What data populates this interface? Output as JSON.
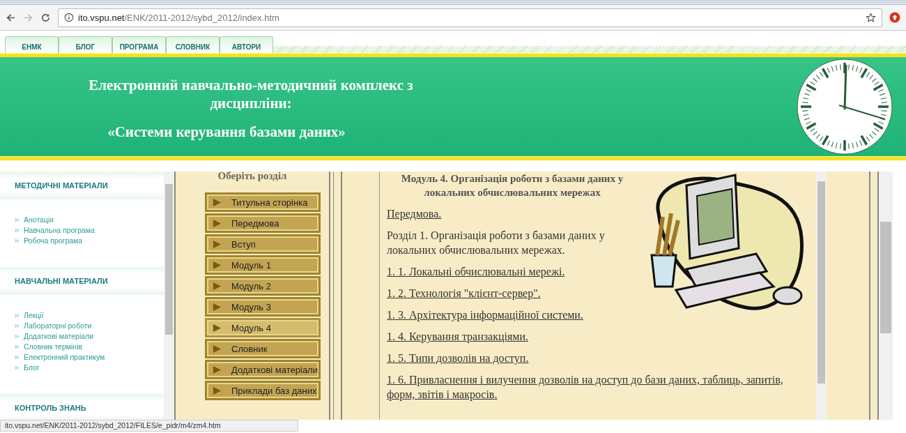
{
  "browser": {
    "url_host": "ito.vspu.net",
    "url_path": "/ENK/2011-2012/sybd_2012/index.htm",
    "status_url": "ito.vspu.net/ENK/2011-2012/sybd_2012/FILES/e_pidr/m4/zm4.htm"
  },
  "nav_tabs": [
    "ЕНМК",
    "БЛОГ",
    "ПРОГРАМА",
    "СЛОВНИК",
    "АВТОРИ"
  ],
  "banner": {
    "title_lines": [
      "Електронний навчально-методичний комплекс з",
      "дисципліни:"
    ],
    "subtitle": "«Системи керування базами даних»"
  },
  "sidebar": {
    "sections": [
      {
        "heading": "МЕТОДИЧНІ МАТЕРІАЛИ",
        "items": [
          "Анотація",
          "Навчальна програма",
          "Робоча програма"
        ]
      },
      {
        "heading": "НАВЧАЛЬНІ МАТЕРІАЛИ",
        "items": [
          "Лекції",
          "Лабораторні роботи",
          "Додаткові матеріали",
          "Словник термінів",
          "Електронний практикум",
          "Блог"
        ]
      },
      {
        "heading": "КОНТРОЛЬ ЗНАНЬ"
      }
    ]
  },
  "menu": {
    "title": "Оберіть розділ",
    "items": [
      {
        "label": "Титульна сторінка",
        "selected": false
      },
      {
        "label": "Передмова",
        "selected": false
      },
      {
        "label": "Вступ",
        "selected": false
      },
      {
        "label": "Модуль 1",
        "selected": false
      },
      {
        "label": "Модуль 2",
        "selected": false
      },
      {
        "label": "Модуль 3",
        "selected": false
      },
      {
        "label": "Модуль 4",
        "selected": true
      },
      {
        "label": "Словник",
        "selected": false
      },
      {
        "label": "Додаткові матеріали",
        "selected": false
      },
      {
        "label": "Приклади баз даних",
        "selected": false
      }
    ]
  },
  "content": {
    "heading_lines": [
      "Модуль 4. Організація роботи з базами даних у",
      "локальних обчислювальних мережах"
    ],
    "paragraphs": [
      {
        "kind": "link",
        "text": "Передмова."
      },
      {
        "kind": "plain",
        "text": "Розділ 1. Організація роботи з базами даних у локальних обчислювальних мережах."
      },
      {
        "kind": "link",
        "text": "1. 1. Локальні обчислювальні мережі."
      },
      {
        "kind": "link",
        "text": "1. 2. Технологія \"клієнт-сервер\"."
      },
      {
        "kind": "link",
        "text": "1. 3. Архітектура інформаційної системи."
      },
      {
        "kind": "link",
        "text": "1. 4. Керування транзакціями."
      },
      {
        "kind": "link",
        "text": "1. 5. Типи дозволів на доступ."
      },
      {
        "kind": "link",
        "text": "1. 6. Привласнення і вилучення дозволів на доступ до бази даних, таблиць, запитів, форм, звітів і макросів."
      }
    ]
  }
}
